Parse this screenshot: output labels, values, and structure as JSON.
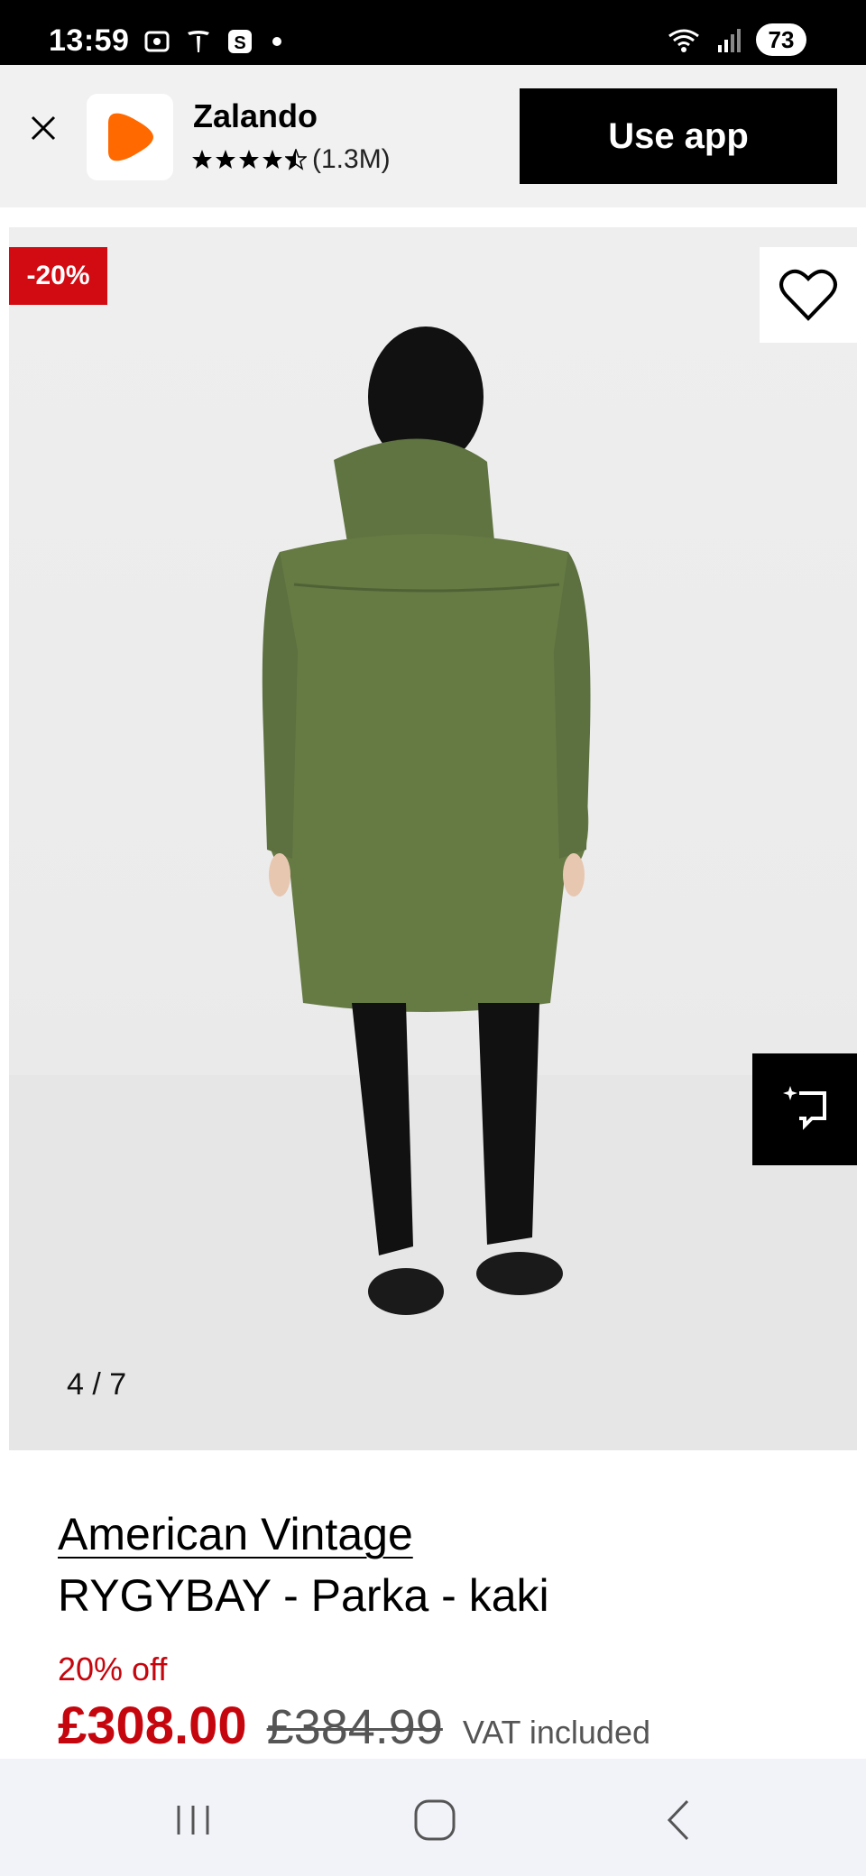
{
  "status_bar": {
    "time": "13:59",
    "battery": "73"
  },
  "app_banner": {
    "app_name": "Zalando",
    "rating_count": "(1.3M)",
    "stars": 4.5,
    "use_app_label": "Use app",
    "brand_color": "#ff6900"
  },
  "gallery": {
    "discount_badge": "-20%",
    "counter": "4 / 7"
  },
  "product": {
    "brand": "American Vintage",
    "name": "RYGYBAY - Parka - kaki",
    "discount_text": "20% off",
    "price_now": "£308.00",
    "price_old": "£384.99",
    "vat_text": "VAT included",
    "sale_color": "#c5060e"
  }
}
